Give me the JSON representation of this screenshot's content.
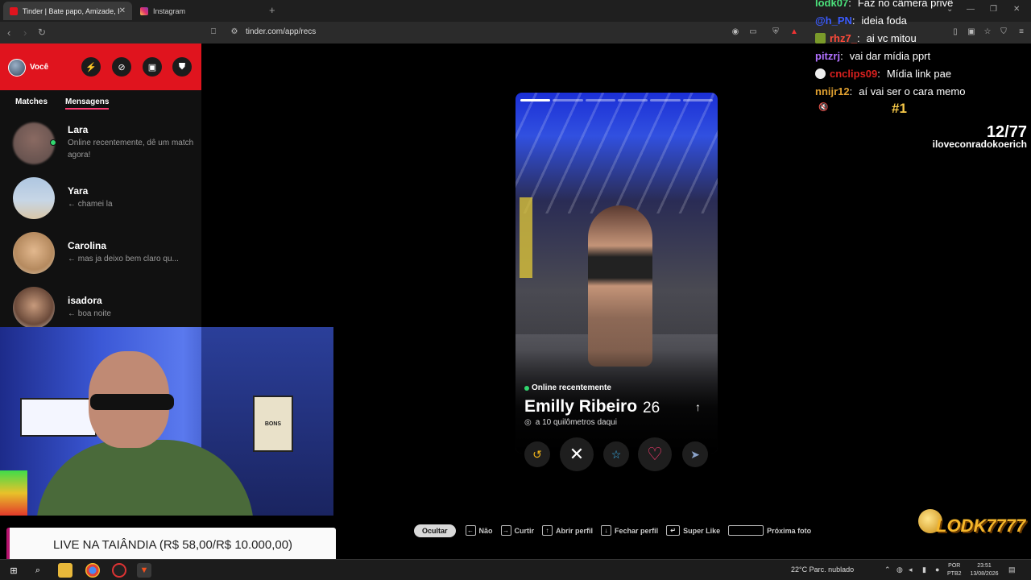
{
  "browser": {
    "tabs": [
      {
        "title": "Tinder | Bate papo, Amizade, En",
        "active": true
      },
      {
        "title": "Instagram",
        "active": false
      }
    ],
    "url": "tinder.com/app/recs"
  },
  "sidebar": {
    "user_label": "Você",
    "tabs": [
      "Matches",
      "Mensagens"
    ],
    "matches": [
      {
        "name": "Lara",
        "message": "Online recentemente, dê um match agora!"
      },
      {
        "name": "Yara",
        "message": "← chamei la"
      },
      {
        "name": "Carolina",
        "message": "← mas ja deixo bem claro qu..."
      },
      {
        "name": "isadora",
        "message": "← boa noite"
      }
    ]
  },
  "profile": {
    "status": "Online recentemente",
    "name": "Emilly Ribeiro",
    "age": "26",
    "distance": "a 10 quilômetros daqui",
    "photos_total": 6,
    "photo_current": 1
  },
  "shortcuts": {
    "hide_label": "Ocultar",
    "items": [
      {
        "key": "←",
        "label": "Não"
      },
      {
        "key": "→",
        "label": "Curtir"
      },
      {
        "key": "↑",
        "label": "Abrir perfil"
      },
      {
        "key": "↓",
        "label": "Fechar perfil"
      },
      {
        "key": "↵",
        "label": "Super Like"
      },
      {
        "key": "",
        "label": "Próxima foto"
      }
    ]
  },
  "stream": {
    "banner": "LIVE NA TAIÂNDIA (R$ 58,00/R$ 10.000,00)",
    "goal_count": "12/77",
    "goal_user": "iloveconradokoerich",
    "rank": "#1",
    "logo_text": "LODK7777",
    "chat": [
      {
        "user": "lodk07",
        "text": "Faz no câmera privê",
        "color": "#4be07a"
      },
      {
        "user": "@h_PN",
        "text": "ideia foda",
        "color": "#3a5bff"
      },
      {
        "user": "rhz7_",
        "text": "ai vc mitou",
        "color": "#ff4a3a"
      },
      {
        "user": "pitzrj",
        "text": "vai dar mídia pprt",
        "color": "#b070ff"
      },
      {
        "user": "cnclips09",
        "text": "Mídia link pae",
        "color": "#d9201e"
      },
      {
        "user": "nnijr12",
        "text": "aí vai ser o cara memo",
        "color": "#e0a030"
      }
    ]
  },
  "taskbar": {
    "weather": "22°C  Parc. nublado",
    "lang_top": "POR",
    "lang_bottom": "PTB2",
    "time": "23:51",
    "date": "13/08/2026"
  },
  "colors": {
    "tinder_red": "#e0141e",
    "like": "#fe3c72",
    "online": "#32d76f"
  }
}
